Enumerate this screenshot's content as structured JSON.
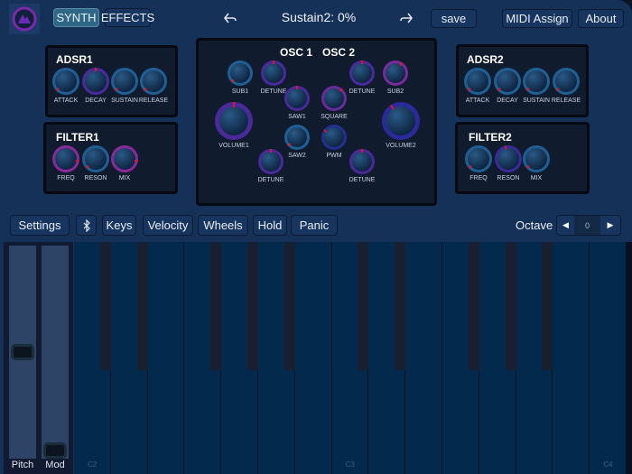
{
  "header": {
    "tabs": [
      {
        "label": "SYNTH",
        "active": true
      },
      {
        "label": "EFFECTS",
        "active": false
      }
    ],
    "title": "Sustain2: 0%",
    "save": "save",
    "midi_assign": "MIDI Assign",
    "about": "About"
  },
  "panels": {
    "adsr1": "ADSR1",
    "filter1": "FILTER1",
    "osc1": "OSC 1",
    "osc2": "OSC 2",
    "adsr2": "ADSR2",
    "filter2": "FILTER2"
  },
  "knobs": [
    {
      "label": "ATTACK",
      "value": 0,
      "color": "#1f5f94"
    },
    {
      "label": "DECAY",
      "value": 0.5,
      "color": "#4a2a9a"
    },
    {
      "label": "SUSTAIN",
      "value": 0,
      "color": "#1f5f94"
    },
    {
      "label": "RELEASE",
      "value": 0,
      "color": "#1f5f94"
    },
    {
      "label": "FREQ",
      "value": 0.87,
      "color": "#8a2a9a"
    },
    {
      "label": "RESON",
      "value": 0,
      "color": "#1f5f94"
    },
    {
      "label": "MIX",
      "value": 0.87,
      "color": "#8a2a9a"
    },
    {
      "label": "SUB1",
      "value": 0,
      "color": "#1f5f94"
    },
    {
      "label": "DETUNE",
      "value": 0.5,
      "color": "#4a2a9a"
    },
    {
      "label": "SAW1",
      "value": 0.5,
      "color": "#4a2a9a"
    },
    {
      "label": "SQUARE",
      "value": 0.65,
      "color": "#6a2a9a"
    },
    {
      "label": "DETUNE",
      "value": 0.5,
      "color": "#4a2a9a"
    },
    {
      "label": "SUB2",
      "value": 0.62,
      "color": "#7a2a9a"
    },
    {
      "label": "VOLUME1",
      "value": 0.5,
      "color": "#4a2a9a"
    },
    {
      "label": "VOLUME2",
      "value": 0.38,
      "color": "#2a2a9a"
    },
    {
      "label": "SAW2",
      "value": 0,
      "color": "#1f5f94"
    },
    {
      "label": "PWM",
      "value": 0.3,
      "color": "#22308f"
    },
    {
      "label": "DETUNE",
      "value": 0.5,
      "color": "#4a2a9a"
    },
    {
      "label": "DETUNE",
      "value": 0.5,
      "color": "#4a2a9a"
    },
    {
      "label": "ATTACK",
      "value": 0,
      "color": "#1f5f94"
    },
    {
      "label": "DECAY",
      "value": 0,
      "color": "#1f5f94"
    },
    {
      "label": "SUSTAIN",
      "value": 0,
      "color": "#1f5f94"
    },
    {
      "label": "RELEASE",
      "value": 0,
      "color": "#1f5f94"
    },
    {
      "label": "FREQ",
      "value": 0,
      "color": "#1f5f94"
    },
    {
      "label": "RESON",
      "value": 0.45,
      "color": "#3a2a9a"
    },
    {
      "label": "MIX",
      "value": 0,
      "color": "#1f5f94"
    }
  ],
  "toolbar": {
    "settings": "Settings",
    "bluetooth_icon": "bluetooth-icon",
    "keys": "Keys",
    "velocity": "Velocity",
    "wheels": "Wheels",
    "hold": "Hold",
    "panic": "Panic",
    "octave_label": "Octave",
    "octave_value": "0"
  },
  "wheels": {
    "pitch_label": "Pitch",
    "mod_label": "Mod",
    "pitch_value": 0.5,
    "mod_value": 0
  },
  "keyboard": {
    "labels": [
      "C2",
      "C3",
      "C4"
    ]
  }
}
